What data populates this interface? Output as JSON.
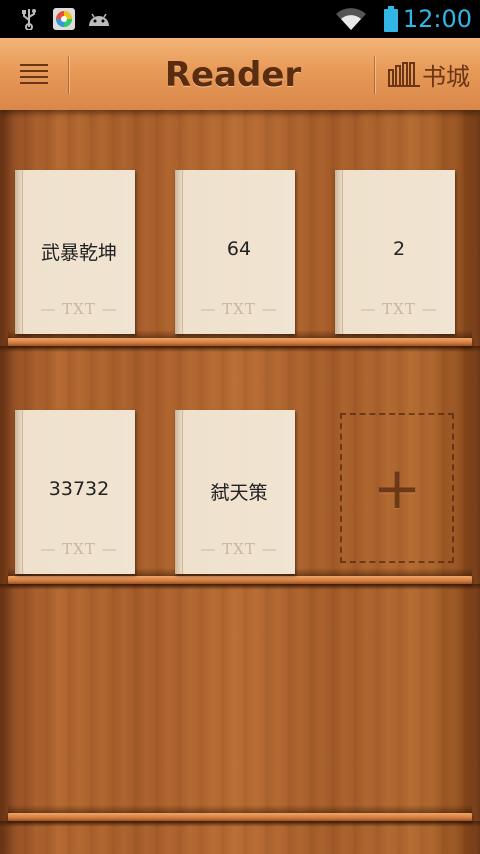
{
  "status_bar": {
    "icons": [
      "usb-icon",
      "app-store-icon",
      "android-icon",
      "wifi-icon",
      "battery-icon"
    ],
    "time": "12:00",
    "time_color": "#33b5e5"
  },
  "header": {
    "title": "Reader",
    "store_label": "书城",
    "menu_icon": "hamburger-menu-icon",
    "store_icon": "bookshelf-icon"
  },
  "shelves": [
    {
      "books": [
        {
          "title": "武暴乾坤",
          "type": "— TXT —"
        },
        {
          "title": "64",
          "type": "— TXT —"
        },
        {
          "title": "2",
          "type": "— TXT —"
        }
      ]
    },
    {
      "books": [
        {
          "title": "33732",
          "type": "— TXT —"
        },
        {
          "title": "弑天策",
          "type": "— TXT —"
        }
      ],
      "add_slot_symbol": "+"
    },
    {
      "books": []
    }
  ]
}
